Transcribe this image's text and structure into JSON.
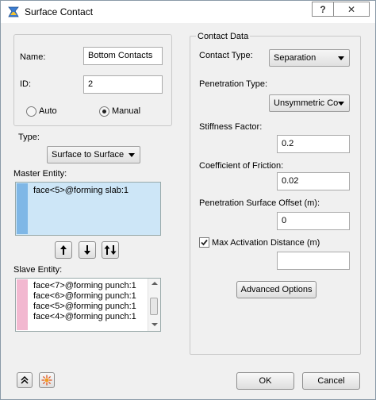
{
  "window": {
    "title": "Surface Contact",
    "help_label": "?",
    "close_label": "✕"
  },
  "left": {
    "name_label": "Name:",
    "name_value": "Bottom Contacts",
    "id_label": "ID:",
    "id_value": "2",
    "auto_label": "Auto",
    "manual_label": "Manual",
    "type_label": "Type:",
    "type_value": "Surface to Surface",
    "master_label": "Master Entity:",
    "master_items": [
      "face<5>@forming slab:1"
    ],
    "slave_label": "Slave Entity:",
    "slave_items": [
      "face<7>@forming punch:1",
      "face<6>@forming punch:1",
      "face<5>@forming punch:1",
      "face<4>@forming punch:1"
    ]
  },
  "right": {
    "group_title": "Contact Data",
    "contact_type_label": "Contact Type:",
    "contact_type_value": "Separation",
    "penetration_type_label": "Penetration Type:",
    "penetration_type_value": "Unsymmetric Co",
    "stiffness_label": "Stiffness Factor:",
    "stiffness_value": "0.2",
    "friction_label": "Coefficient of Friction:",
    "friction_value": "0.02",
    "offset_label": "Penetration Surface Offset (m):",
    "offset_value": "0",
    "max_activation_label": "Max Activation Distance (m)",
    "max_activation_value": "",
    "advanced_label": "Advanced Options"
  },
  "footer": {
    "ok_label": "OK",
    "cancel_label": "Cancel"
  },
  "colors": {
    "master_stripe": "#7fb7e6",
    "master_bg": "#cde6f7",
    "slave_stripe": "#f2b8d0"
  }
}
